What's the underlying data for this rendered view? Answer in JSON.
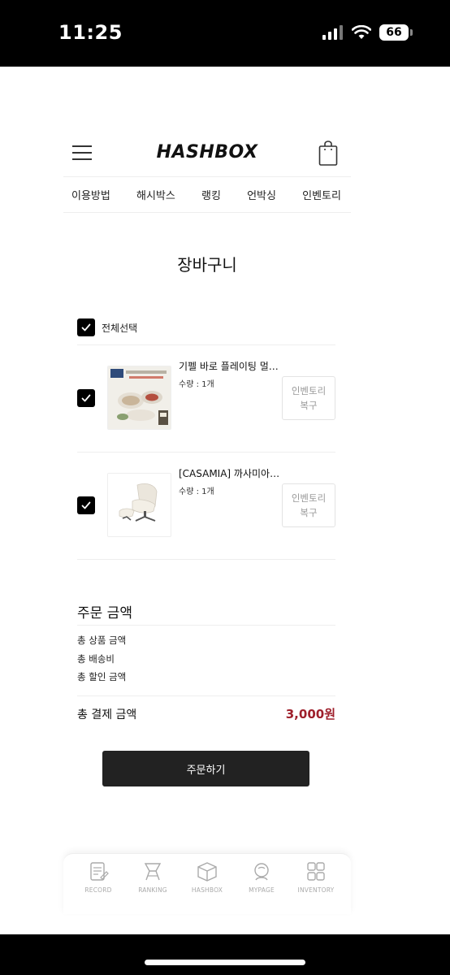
{
  "status_bar": {
    "time": "11:25",
    "battery": "66"
  },
  "header": {
    "logo": "HASHBOX"
  },
  "nav": {
    "items": [
      "이용방법",
      "해시박스",
      "랭킹",
      "언박싱",
      "인벤토리"
    ]
  },
  "page": {
    "title": "장바구니"
  },
  "cart": {
    "select_all_label": "전체선택",
    "items": [
      {
        "name": "기펠 바로 플레이팅 멀…",
        "quantity": "수량 : 1개",
        "restore_line1": "인벤토리",
        "restore_line2": "복구"
      },
      {
        "name": "[CASAMIA] 까사미아…",
        "quantity": "수량 : 1개",
        "restore_line1": "인벤토리",
        "restore_line2": "복구"
      }
    ]
  },
  "order_summary": {
    "title": "주문 금액",
    "product_total_label": "총 상품 금액",
    "shipping_label": "총 배송비",
    "discount_label": "총 할인 금액",
    "payment_total_label": "총 결제 금액",
    "payment_total_value": "3,000원",
    "accent_color": "#9e1f2b"
  },
  "order_button": {
    "label": "주문하기"
  },
  "tabbar": {
    "tabs": [
      {
        "label": "RECORD",
        "icon": "record-icon"
      },
      {
        "label": "RANKING",
        "icon": "ranking-icon"
      },
      {
        "label": "HASHBOX",
        "icon": "box-icon"
      },
      {
        "label": "MYPAGE",
        "icon": "mypage-icon"
      },
      {
        "label": "INVENTORY",
        "icon": "inventory-icon"
      }
    ]
  }
}
